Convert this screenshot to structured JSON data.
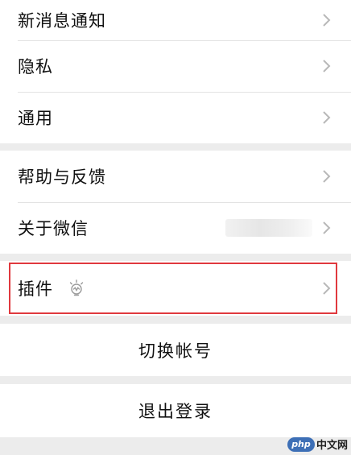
{
  "settings": {
    "group1": {
      "new_message_notification": "新消息通知",
      "privacy": "隐私",
      "general": "通用"
    },
    "group2": {
      "help_feedback": "帮助与反馈",
      "about_wechat": "关于微信"
    },
    "group3": {
      "plugins": "插件"
    },
    "switch_account": "切换帐号",
    "logout": "退出登录"
  },
  "icons": {
    "chevron": "chevron-right-icon",
    "plugin": "lightbulb-icon"
  },
  "colors": {
    "highlight_border": "#e0393e",
    "section_gap": "#ececec",
    "chevron": "#b8b8b8"
  },
  "watermark": {
    "badge": "php",
    "text": "中文网"
  }
}
